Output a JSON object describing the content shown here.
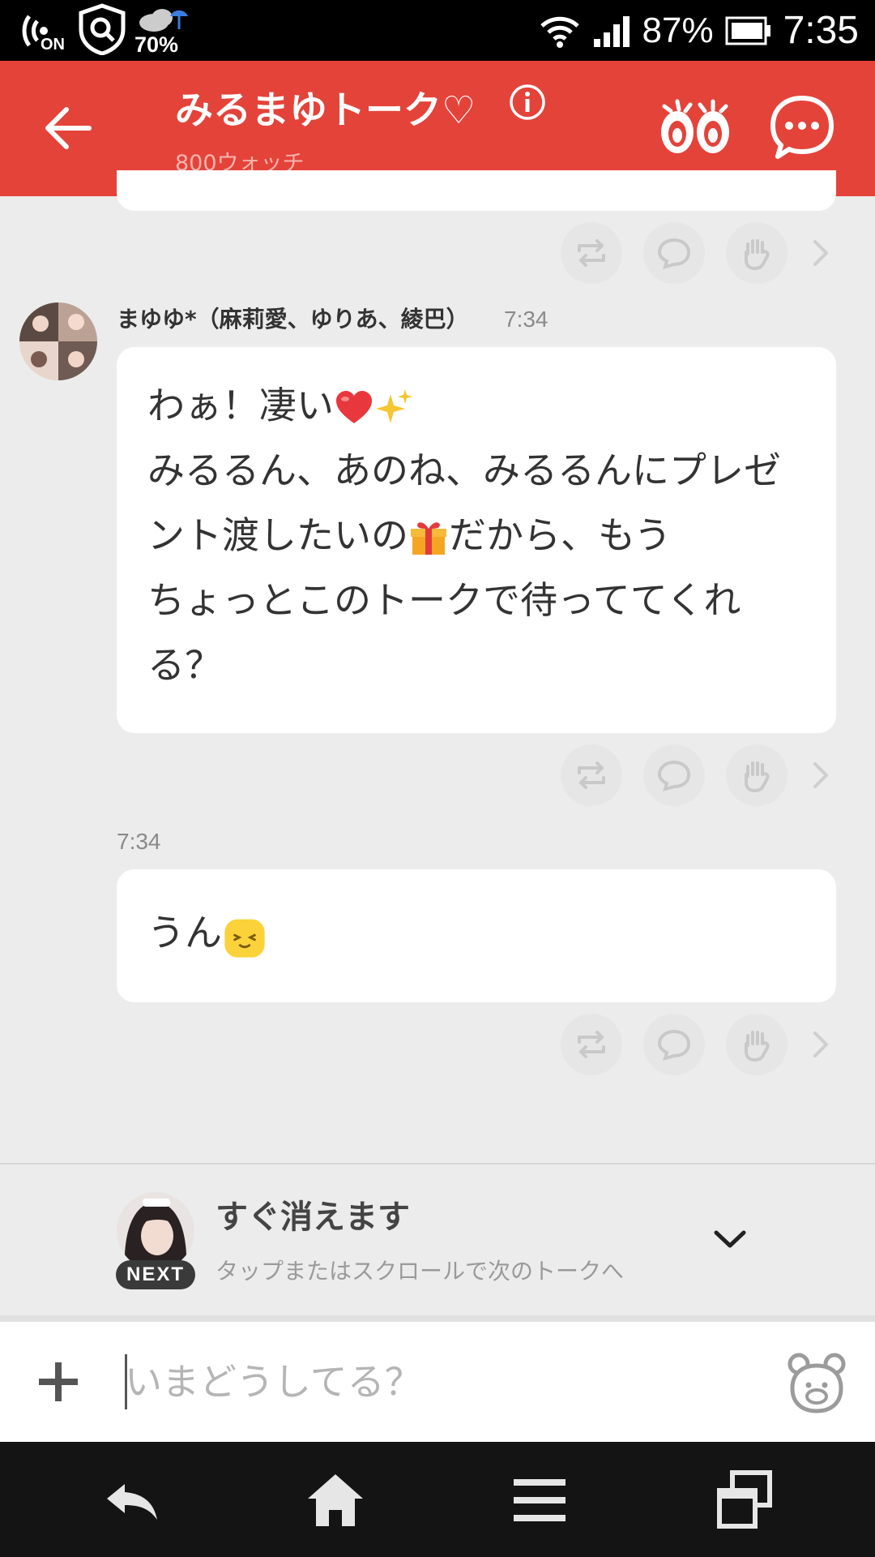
{
  "status_bar": {
    "left_badge": "ON",
    "weather_percent": "70%",
    "battery_percent": "87%",
    "time": "7:35"
  },
  "header": {
    "title": "みるまゆトーク♡",
    "subtitle": "800ウォッチ",
    "accent_color": "#e4433a"
  },
  "messages": [
    {
      "sender": "まゆゆ*（麻莉愛、ゆりあ、綾巴）",
      "time": "7:34",
      "lines": [
        {
          "text_before": "わぁ！凄い",
          "emojis": [
            "heart-emoji",
            "sparkles-emoji"
          ]
        },
        {
          "text_before": "みるるん、あのね、みるるんにプレゼ"
        },
        {
          "text_before": "ント渡したいの",
          "emojis": [
            "gift-emoji"
          ],
          "text_after": "だから、もう"
        },
        {
          "text_before": "ちょっとこのトークで待っててくれ"
        },
        {
          "text_before": "る？"
        }
      ]
    },
    {
      "time": "7:34",
      "text": "うん",
      "emoji": "smile-emoji"
    }
  ],
  "next_talk": {
    "badge": "NEXT",
    "title": "すぐ消えます",
    "subtitle": "タップまたはスクロールで次のトークへ"
  },
  "input": {
    "placeholder": "いまどうしてる？"
  }
}
